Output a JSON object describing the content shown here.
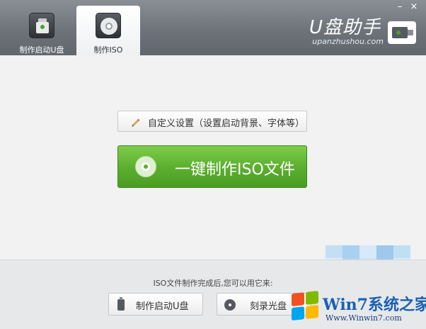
{
  "header": {
    "tabs": [
      {
        "label": "制作启动U盘",
        "icon": "usb-drive-icon",
        "active": false
      },
      {
        "label": "制作ISO",
        "icon": "disc-icon",
        "active": true
      }
    ],
    "brand_title": "U盘助手",
    "brand_domain": "upanzhushou.com",
    "minimize_label": "–",
    "close_label": "×"
  },
  "main": {
    "settings_label": "自定义设置（设置启动背景、字体等）",
    "primary_label": "一键制作ISO文件"
  },
  "footer": {
    "hint": "ISO文件制作完成后,您可以用它来:",
    "buttons": [
      {
        "label": "制作启动U盘",
        "icon": "usb-small-icon"
      },
      {
        "label": "刻录光盘",
        "icon": "disc-small-icon"
      }
    ]
  },
  "watermark": {
    "text": "Win7系统之家",
    "url": "Www.Winwin7.com"
  },
  "colors": {
    "header": "#6c7178",
    "primary_green": "#5cb030",
    "watermark_blue": "#1a5fb4",
    "mosaic": [
      "#c4dff5",
      "#a8d0f0",
      "#d6e9f8",
      "#9fc8ec",
      "#bfe0f4",
      "#e0eef9",
      "#b4d6f2",
      "#cfe5f6",
      "#a2cbee",
      "#d9ebf8",
      "#bcdaf3",
      "#cce3f5"
    ]
  }
}
